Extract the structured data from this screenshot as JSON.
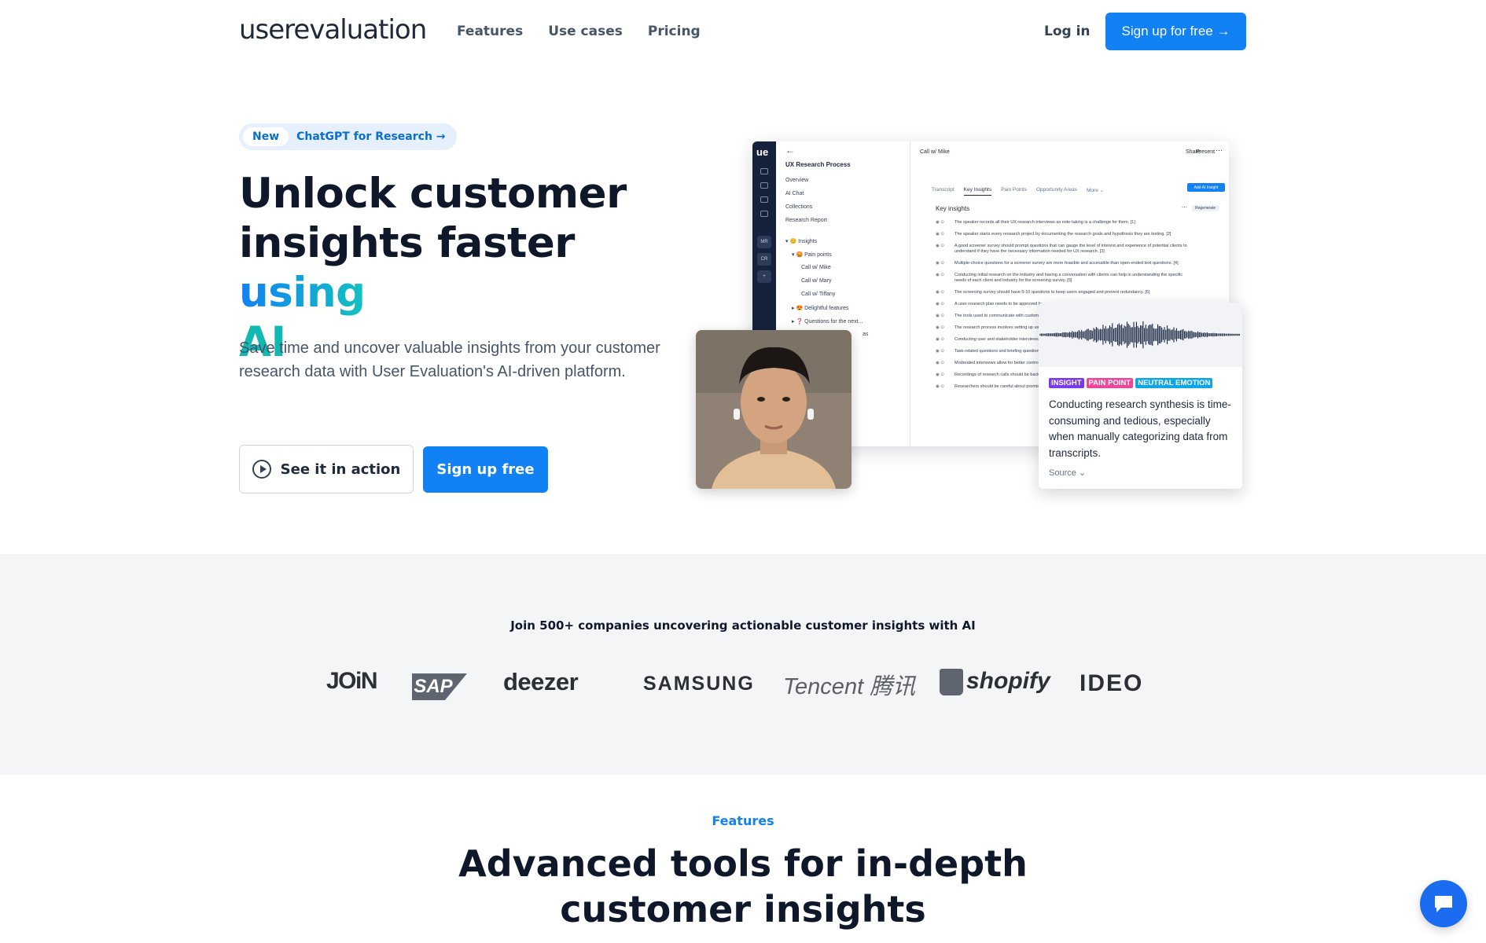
{
  "nav": {
    "logo": "userevaluation",
    "links": [
      "Features",
      "Use cases",
      "Pricing"
    ],
    "login": "Log in",
    "signup": "Sign up for free →"
  },
  "hero": {
    "pill_new": "New",
    "pill_text": "ChatGPT for Research →",
    "title_part1": "Unlock customer insights faster ",
    "title_highlight": "using",
    "title_ai": "AI",
    "subtitle": "Save time and uncover valuable insights from your customer research data with User Evaluation's AI-driven platform.",
    "btn_action": "See it in action",
    "btn_signup": "Sign up free"
  },
  "mockup": {
    "rail_logo": "ue",
    "rail_badges": [
      "MR",
      "CR",
      "+"
    ],
    "back": "←",
    "project": "UX Research Process",
    "sidebar": [
      "Overview",
      "AI Chat",
      "Collections",
      "Research Report",
      "▾ 😊 Insights",
      "▾ 😡 Pain points",
      "Call w/ Mike",
      "Call w/ Mary",
      "Call w/ Tiffany",
      "▸ 😍 Delightful features",
      "▸ ❓ Questions for the next...",
      "as"
    ],
    "call": "Call w/ Mike",
    "share": "Share",
    "present": "Present",
    "more_dots": "⋯",
    "tabs": [
      "Transcript",
      "Key Insights",
      "Pain Points",
      "Opportunity Areas",
      "More ⌄"
    ],
    "add_btn": "Add AI Insight",
    "key_title": "Key insights",
    "regenerate": "Regenerate",
    "rows": [
      "The speaker records all their UX research interviews as note-taking is a challenge for them. [1]",
      "The speaker starts every research project by documenting the research goals and hypothesis they are testing. [2]",
      "A good screener survey should prompt questions that can gauge the level of interest and experience of potential clients to understand if they have the necessary information needed for UX research. [3]",
      "Multiple-choice questions for a screener survey are more feasible and accessible than open-ended text questions. [4]",
      "Conducting initial research on the industry and having a conversation with clients can help in understanding the specific needs of each client and industry for the screening survey. [5]",
      "The screening survey should have 5-10 questions to keep users engaged and prevent redundancy. [6]",
      "A user research plan needs to be approved by",
      "The tools used to communicate with customer",
      "The research process involves setting up user",
      "Conducting user and stakeholder interviews a what is not for a project. [7]",
      "Task-related questions and briefing questions questionnaire. [8]",
      "Moderated interviews allow for better control method. [9]",
      "Recordings of research calls should be backed",
      "Researchers should be careful about promising promised. [10]"
    ]
  },
  "insight_card": {
    "tags": [
      {
        "label": "INSIGHT",
        "color": "#7c3aed"
      },
      {
        "label": "PAIN POINT",
        "color": "#ec4899"
      },
      {
        "label": "NEUTRAL EMOTION",
        "color": "#0ea5e9"
      }
    ],
    "text": "Conducting research synthesis is time-consuming and tedious, especially when manually categorizing data from transcripts.",
    "source": "Source ⌄"
  },
  "logos": {
    "heading": "Join 500+ companies uncovering actionable customer insights with AI",
    "items": [
      "JOiN",
      "SAP",
      "deezer",
      "SAMSUNG",
      "Tencent 腾讯",
      "shopify",
      "IDEO"
    ]
  },
  "features": {
    "label": "Features",
    "title_line1": "Advanced tools for in-depth",
    "title_line2": "customer insights"
  },
  "colors": {
    "primary": "#1181f4",
    "accent_teal": "#12b8b2",
    "band_bg": "#f4f5f7"
  }
}
